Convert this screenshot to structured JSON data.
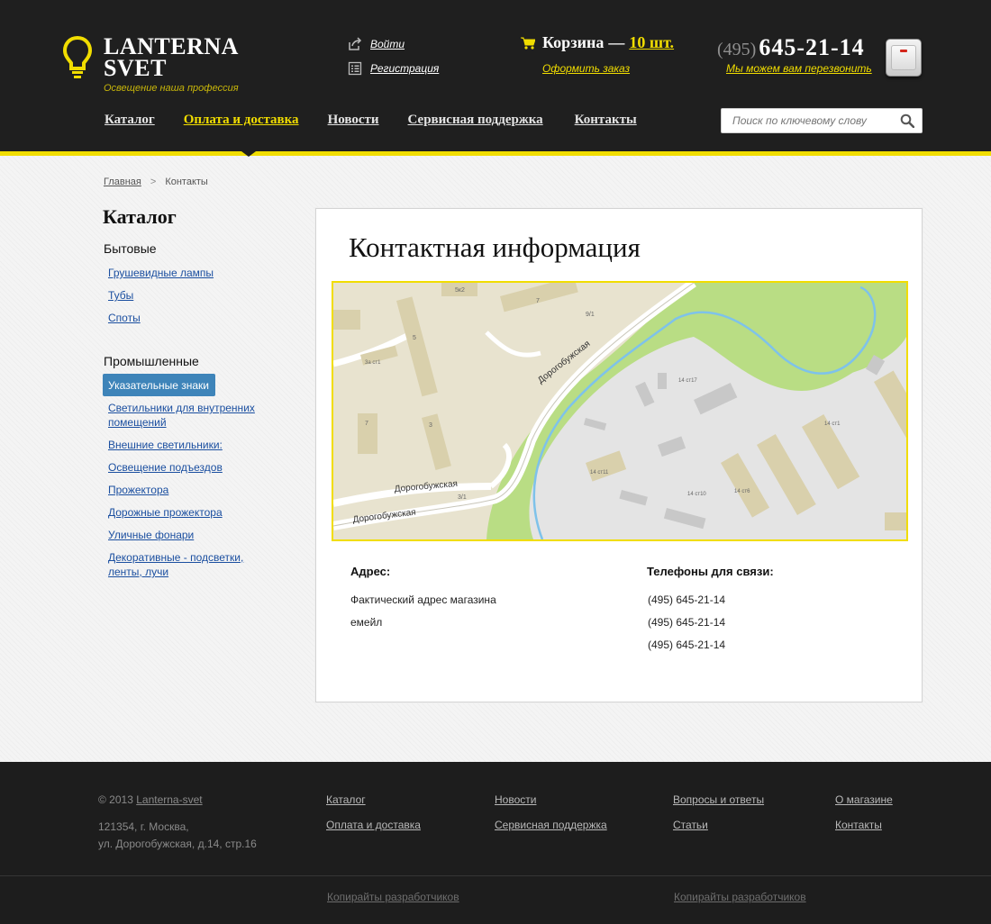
{
  "brand": {
    "title_line1": "LANTERNA",
    "title_line2": "SVET",
    "tagline": "Освещение наша профессия",
    "accent_color": "#f1dd00",
    "logo_icon": "lightbulb-icon"
  },
  "auth": {
    "login_label": "Войти",
    "register_label": "Регистрация"
  },
  "cart": {
    "label": "Корзина",
    "dash": "—",
    "count": "10 шт.",
    "order_link": "Оформить заказ"
  },
  "phone": {
    "code": "(495)",
    "number": "645-21-14",
    "callback": "Мы можем вам перезвонить"
  },
  "nav": {
    "items": [
      {
        "label": "Каталог",
        "active": false
      },
      {
        "label": "Оплата и доставка",
        "active": true
      },
      {
        "label": "Новости",
        "active": false
      },
      {
        "label": "Сервисная поддержка",
        "active": false
      },
      {
        "label": "Контакты",
        "active": false
      }
    ]
  },
  "search": {
    "placeholder": "Поиск по ключевому слову"
  },
  "breadcrumb": {
    "home": "Главная",
    "separator": ">",
    "current": "Контакты"
  },
  "sidebar": {
    "title": "Каталог",
    "group1": "Бытовые",
    "group1_items": [
      "Грушевидные лампы",
      "Тубы",
      "Споты"
    ],
    "group2": "Промышленные",
    "group2_items": [
      "Указательные знаки",
      "Светильники для внутренних помещений",
      "Внешние светильники:",
      "Освещение подъездов",
      "Прожектора",
      "Дорожные прожектора",
      "Уличные фонари",
      "Декоративные - подсветки, ленты, лучи"
    ],
    "active_item": "Указательные знаки",
    "active_color": "#3e84b9"
  },
  "content": {
    "title": "Контактная информация",
    "map_labels": {
      "street1": "Дорогобужская",
      "street2": "Дорогобужская",
      "street3": "Дорогобужская",
      "b1": "5к2",
      "b2": "7",
      "b3": "9/1",
      "b4": "5",
      "b5": "3а ст1",
      "b6": "7",
      "b7": "3",
      "b8": "3/1",
      "b9": "14 ст17",
      "b10": "14 ст1",
      "b11": "14 ст11",
      "b12": "14 ст10",
      "b13": "14 ст6"
    },
    "address_label": "Адрес:",
    "address_lines": [
      "Фактический адрес магазина",
      "емейл"
    ],
    "phones_label": "Телефоны для связи:",
    "phones": [
      "(495) 645-21-14",
      "(495) 645-21-14",
      "(495) 645-21-14"
    ]
  },
  "footer": {
    "copyright_prefix": "© 2013",
    "copyright_link": "Lanterna-svet",
    "address_line1": "121354, г. Москва,",
    "address_line2": "ул. Дорогобужская, д.14, стр.16",
    "col1": [
      "Каталог",
      "Оплата и доставка"
    ],
    "col2": [
      "Новости",
      "Сервисная поддержка"
    ],
    "col3": [
      "Вопросы и ответы",
      "Статьи"
    ],
    "col4": [
      "О магазине",
      "Контакты"
    ],
    "dev_links": [
      "Копирайты разработчиков",
      "Копирайты разработчиков"
    ]
  }
}
